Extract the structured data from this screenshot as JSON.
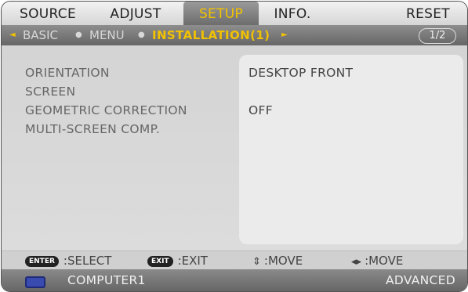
{
  "tabs": [
    {
      "label": "SOURCE",
      "active": false
    },
    {
      "label": "ADJUST",
      "active": false
    },
    {
      "label": "SETUP",
      "active": true
    },
    {
      "label": "INFO.",
      "active": false
    },
    {
      "label": "RESET",
      "active": false
    }
  ],
  "subnav": {
    "left_arrow": "◄",
    "items": [
      "BASIC",
      "MENU"
    ],
    "current": "INSTALLATION(1)",
    "right_arrow": "►",
    "separator": "●",
    "page": "1/2"
  },
  "settings": [
    {
      "label": "ORIENTATION",
      "value": "DESKTOP FRONT"
    },
    {
      "label": "SCREEN",
      "value": ""
    },
    {
      "label": "GEOMETRIC CORRECTION",
      "value": "OFF"
    },
    {
      "label": "MULTI-SCREEN COMP.",
      "value": ""
    }
  ],
  "help": {
    "select": {
      "key": "ENTER",
      "text": ":SELECT"
    },
    "exit": {
      "key": "EXIT",
      "text": ":EXIT"
    },
    "move_vertical": {
      "symbol": "⇕",
      "text": ":MOVE"
    },
    "move_horizontal": {
      "symbol": "◂▸",
      "text": ":MOVE"
    }
  },
  "status": {
    "source_icon": "computer-input-icon",
    "source": "COMPUTER1",
    "mode": "ADVANCED"
  },
  "colors": {
    "accent": "#f2c200",
    "active_tab_bg": "#7a7a7a"
  }
}
